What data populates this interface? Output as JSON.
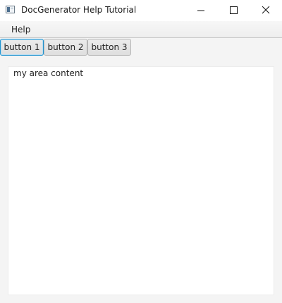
{
  "window": {
    "title": "DocGenerator Help Tutorial",
    "icon": "app-window-icon",
    "controls": [
      "minimize-icon",
      "maximize-icon",
      "close-icon"
    ]
  },
  "menubar": {
    "items": [
      {
        "label": "Help"
      }
    ]
  },
  "toolbar": {
    "buttons": [
      {
        "label": "button 1",
        "focused": true
      },
      {
        "label": "button 2",
        "focused": false
      },
      {
        "label": "button 3",
        "focused": false
      }
    ]
  },
  "main": {
    "area_content": "my area content"
  },
  "colors": {
    "window_bg": "#f4f4f4",
    "focus_border": "#1f93d0",
    "area_bg": "#ffffff"
  }
}
